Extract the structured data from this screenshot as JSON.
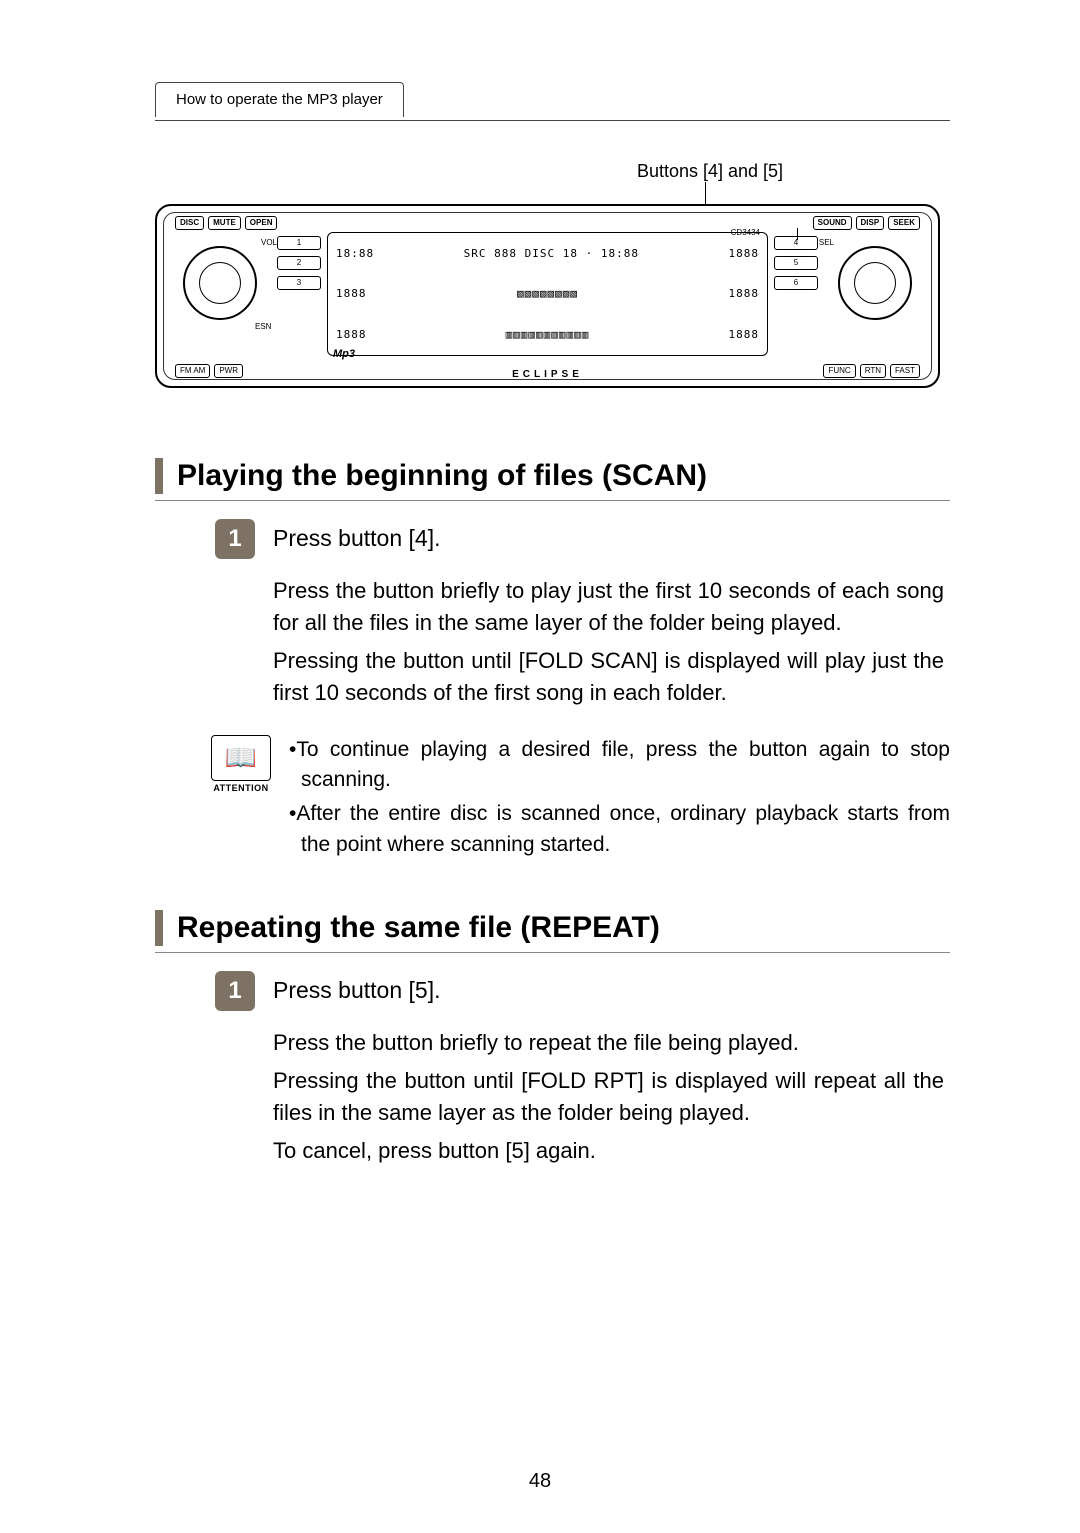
{
  "header": {
    "tab": "How to operate the MP3 player"
  },
  "callout": "Buttons [4] and [5]",
  "device": {
    "top_left_buttons": [
      "DISC",
      "MUTE",
      "OPEN"
    ],
    "top_right_buttons": [
      "SOUND",
      "DISP",
      "SEEK"
    ],
    "left_small": [
      "VOL",
      "ESN"
    ],
    "right_small": [
      "SEL"
    ],
    "bottom_left_buttons": [
      "FM AM",
      "PWR"
    ],
    "bottom_right_buttons": [
      "FUNC",
      "RTN",
      "FAST"
    ],
    "left_numcol": [
      "1",
      "2",
      "3"
    ],
    "right_numcol": [
      "4",
      "5",
      "6"
    ],
    "lcd_line1_left": "18:88",
    "lcd_line1_mid": "SRC 888 DISC 18 · 18:88",
    "lcd_line1_right": "1888",
    "lcd_line2_left": "1888",
    "lcd_line2_mid": "▧▧▧▧▧▧▧▧",
    "lcd_line2_right": "1888",
    "lcd_line3_left": "1888",
    "lcd_line3_mid": "▥▥▥▥▥▥▥▥▥▥▥",
    "lcd_line3_right": "1888",
    "cd_model": "CD3434",
    "mp3_label": "Mp3",
    "brand": "ECLIPSE"
  },
  "scan": {
    "title": "Playing the beginning of files (SCAN)",
    "step_num": "1",
    "step_title": "Press button [4].",
    "p1": "Press the button briefly to play just the first 10 seconds of each song for all the files in the same layer of the folder being played.",
    "p2": "Pressing the button until [FOLD SCAN] is displayed will play just the first 10 seconds of the first song in each folder.",
    "att_label": "ATTENTION",
    "att1": "•To continue playing a desired file, press the button again to stop scanning.",
    "att2": "•After the entire disc is scanned once, ordinary playback starts from the point where scanning started."
  },
  "repeat": {
    "title": "Repeating the same file (REPEAT)",
    "step_num": "1",
    "step_title": "Press button [5].",
    "p1": "Press the button briefly to repeat the file being played.",
    "p2": "Pressing the button until [FOLD RPT] is displayed will repeat all the files in the same layer as the folder being played.",
    "p3": "To cancel, press button [5] again."
  },
  "page_number": "48"
}
